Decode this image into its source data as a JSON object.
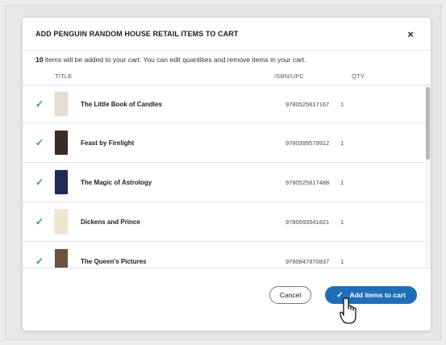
{
  "modal": {
    "title": "ADD PENGUIN RANDOM HOUSE RETAIL ITEMS TO CART",
    "close_label": "×",
    "desc_count": "10",
    "desc_text": " items will be added to your cart. You can edit quantities and remove items in your cart."
  },
  "table": {
    "headers": {
      "title": "TITLE",
      "isbn": "ISBN/UPC",
      "qty": "QTY"
    },
    "rows": [
      {
        "title": "The Little Book of Candles",
        "isbn": "9780525617167",
        "qty": "1",
        "status_icon": "check-icon",
        "cover_color": "#e9ddd0"
      },
      {
        "title": "Feast by Firelight",
        "isbn": "9780399579912",
        "qty": "1",
        "status_icon": "check-icon",
        "cover_color": "#3a2a24"
      },
      {
        "title": "The Magic of Astrology",
        "isbn": "9780525617488",
        "qty": "1",
        "status_icon": "check-icon",
        "cover_color": "#1d2c52"
      },
      {
        "title": "Dickens and Prince",
        "isbn": "9780593541821",
        "qty": "1",
        "status_icon": "check-icon",
        "cover_color": "#efe6cf"
      },
      {
        "title": "The Queen's Pictures",
        "isbn": "9780847870837",
        "qty": "1",
        "status_icon": "check-icon",
        "cover_color": "#6b5340"
      }
    ]
  },
  "footer": {
    "cancel_label": "Cancel",
    "add_label": "Add items to cart"
  },
  "colors": {
    "accent": "#1e6fb8",
    "check": "#2e9c58"
  }
}
